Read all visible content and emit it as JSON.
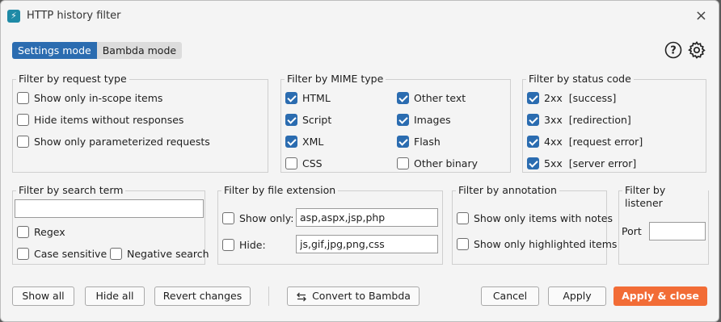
{
  "window": {
    "title": "HTTP history filter",
    "app_icon": "lightning-icon",
    "close": "×"
  },
  "modes": {
    "settings": "Settings mode",
    "bambda": "Bambda mode",
    "active": "settings"
  },
  "header_icons": [
    "help-icon",
    "gear-icon"
  ],
  "request_type": {
    "title": "Filter by request type",
    "items": [
      {
        "label": "Show only in-scope items",
        "checked": false
      },
      {
        "label": "Hide items without responses",
        "checked": false
      },
      {
        "label": "Show only parameterized requests",
        "checked": false
      }
    ]
  },
  "mime": {
    "title": "Filter by MIME type",
    "items": [
      {
        "label": "HTML",
        "checked": true
      },
      {
        "label": "Other text",
        "checked": true
      },
      {
        "label": "Script",
        "checked": true
      },
      {
        "label": "Images",
        "checked": true
      },
      {
        "label": "XML",
        "checked": true
      },
      {
        "label": "Flash",
        "checked": true
      },
      {
        "label": "CSS",
        "checked": false
      },
      {
        "label": "Other binary",
        "checked": false
      }
    ]
  },
  "status": {
    "title": "Filter by status code",
    "items": [
      {
        "label": "2xx  [success]",
        "checked": true
      },
      {
        "label": "3xx  [redirection]",
        "checked": true
      },
      {
        "label": "4xx  [request error]",
        "checked": true
      },
      {
        "label": "5xx  [server error]",
        "checked": true
      }
    ]
  },
  "search": {
    "title": "Filter by search term",
    "value": "",
    "regex": "Regex",
    "case_sensitive": "Case sensitive",
    "negative": "Negative search"
  },
  "extension": {
    "title": "Filter by file extension",
    "show_only_label": "Show only:",
    "show_only_value": "asp,aspx,jsp,php",
    "hide_label": "Hide:",
    "hide_value": "js,gif,jpg,png,css"
  },
  "annotation": {
    "title": "Filter by annotation",
    "notes": "Show only items with notes",
    "highlighted": "Show only highlighted items"
  },
  "listener": {
    "title": "Filter by listener",
    "port_label": "Port",
    "port_value": ""
  },
  "buttons": {
    "show_all": "Show all",
    "hide_all": "Hide all",
    "revert": "Revert changes",
    "convert": "Convert to Bambda",
    "cancel": "Cancel",
    "apply": "Apply",
    "apply_close": "Apply & close"
  },
  "colors": {
    "accent": "#2b6cb0",
    "primary_button": "#f26c36",
    "app_icon": "#1f8aa6"
  }
}
